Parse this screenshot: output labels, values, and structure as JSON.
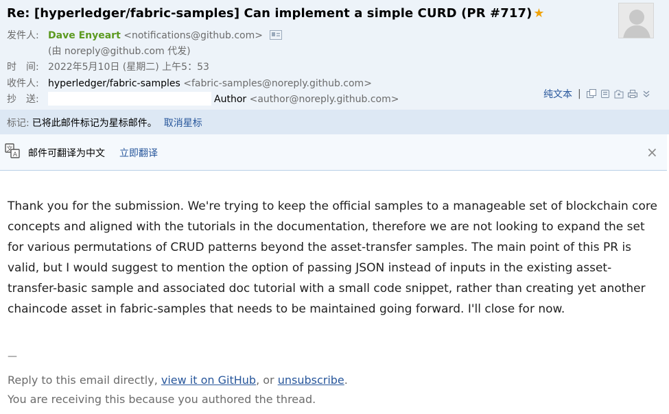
{
  "email": {
    "subject": "Re: [hyperledger/fabric-samples] Can implement a simple CURD (PR #717)",
    "star_icon": "star-icon",
    "from_label": "发件人:",
    "sender_name": "Dave Enyeart",
    "sender_email": "<notifications@github.com>",
    "via_note": "(由 noreply@github.com 代发)",
    "time_label": "时　间:",
    "time_value": "2022年5月10日 (星期二) 上午5：53",
    "to_label": "收件人:",
    "to_name": "hyperledger/fabric-samples",
    "to_email": "<fabric-samples@noreply.github.com>",
    "cc_label": "抄　送:",
    "cc_name": "Author",
    "cc_email": "<author@noreply.github.com>"
  },
  "toolbar": {
    "plain_text": "纯文本",
    "separator": "|",
    "icons": [
      "new-window-icon",
      "print-preview-icon",
      "save-icon",
      "print-icon",
      "more-chevron-icon"
    ]
  },
  "flag_bar": {
    "label": "标记:",
    "text": "已将此邮件标记为星标邮件。",
    "link": "取消星标"
  },
  "translate_bar": {
    "text": "邮件可翻译为中文",
    "link": "立即翻译",
    "close": "×"
  },
  "body": {
    "paragraph": "Thank you for the submission. We're trying to keep the official samples to a manageable set of blockchain core concepts and aligned with the tutorials in the documentation, therefore we are not looking to expand the set for various permutations of CRUD patterns beyond the asset-transfer samples. The main point of this PR is valid, but I would suggest to mention the option of passing JSON instead of inputs in the existing asset-transfer-basic sample and associated doc tutorial with a small code snippet, rather than creating yet another chaincode asset in fabric-samples that needs to be maintained going forward. I'll close for now.",
    "dash": "—"
  },
  "footer": {
    "reply_prefix": "Reply to this email directly, ",
    "view_link": "view it on GitHub",
    "or_text": ", or ",
    "unsubscribe_link": "unsubscribe",
    "period": ".",
    "reason": "You are receiving this because you authored the thread."
  }
}
